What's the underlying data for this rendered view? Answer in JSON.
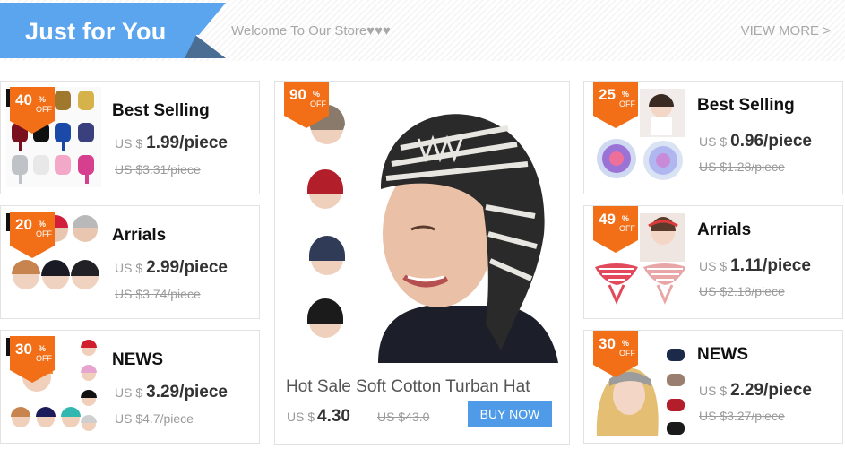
{
  "banner": {
    "title": "Just for You",
    "welcome": "Welcome To Our Store♥♥♥",
    "view_more": "VIEW MORE >",
    "colors": {
      "title_bg": "#5ba4ee",
      "title_tail": "#4a6d93"
    }
  },
  "badge_color": "#f26f17",
  "left_cards": [
    {
      "discount": "40",
      "percent_sign": "%",
      "off": "OFF",
      "title": "Best Selling",
      "currency": "US $",
      "price": "1.99/piece",
      "old_price": "US $3.31/piece"
    },
    {
      "discount": "20",
      "percent_sign": "%",
      "off": "OFF",
      "title": "Arrials",
      "currency": "US $",
      "price": "2.99/piece",
      "old_price": "US $3.74/piece"
    },
    {
      "discount": "30",
      "percent_sign": "%",
      "off": "OFF",
      "title": "NEWS",
      "currency": "US $",
      "price": "3.29/piece",
      "old_price": "US $4.7/piece"
    }
  ],
  "feature": {
    "discount": "90",
    "percent_sign": "%",
    "off": "OFF",
    "title": "Hot Sale Soft Cotton Turban Hat",
    "currency": "US $",
    "price": "4.30",
    "old_price": "US $43.0",
    "button": "BUY NOW"
  },
  "right_cards": [
    {
      "discount": "25",
      "percent_sign": "%",
      "off": "OFF",
      "title": "Best Selling",
      "currency": "US $",
      "price": "0.96/piece",
      "old_price": "US $1.28/piece"
    },
    {
      "discount": "49",
      "percent_sign": "%",
      "off": "OFF",
      "title": "Arrials",
      "currency": "US $",
      "price": "1.11/piece",
      "old_price": "US $2.18/piece"
    },
    {
      "discount": "30",
      "percent_sign": "%",
      "off": "OFF",
      "title": "NEWS",
      "currency": "US $",
      "price": "2.29/piece",
      "old_price": "US $3.27/piece"
    }
  ]
}
